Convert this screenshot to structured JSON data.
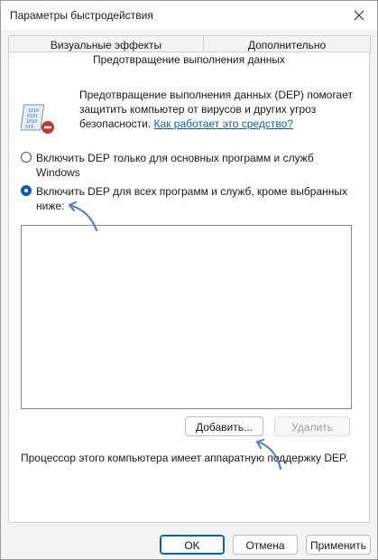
{
  "window": {
    "title": "Параметры быстродействия"
  },
  "tabs": [
    {
      "label": "Визуальные эффекты"
    },
    {
      "label": "Дополнительно"
    }
  ],
  "active_tab": {
    "label": "Предотвращение выполнения данных"
  },
  "description": {
    "text": "Предотвращение выполнения данных (DEP) помогает защитить компьютер от вирусов и других угроз безопасности.",
    "link": "Как работает это средство?"
  },
  "options": [
    {
      "label": "Включить DEP только для основных программ и служб Windows",
      "checked": false
    },
    {
      "label": "Включить DEP для всех программ и служб, кроме выбранных ниже:",
      "checked": true
    }
  ],
  "exclusions": {
    "items": []
  },
  "list_buttons": {
    "add": "Добавить...",
    "remove": "Удалить"
  },
  "hardware_note": "Процессор этого компьютера имеет аппаратную поддержку DEP.",
  "dialog_buttons": {
    "ok": "OK",
    "cancel": "Отмена",
    "apply": "Применить"
  },
  "accent_color": "#0a5fb4",
  "annotation_color": "#5b7fc9"
}
